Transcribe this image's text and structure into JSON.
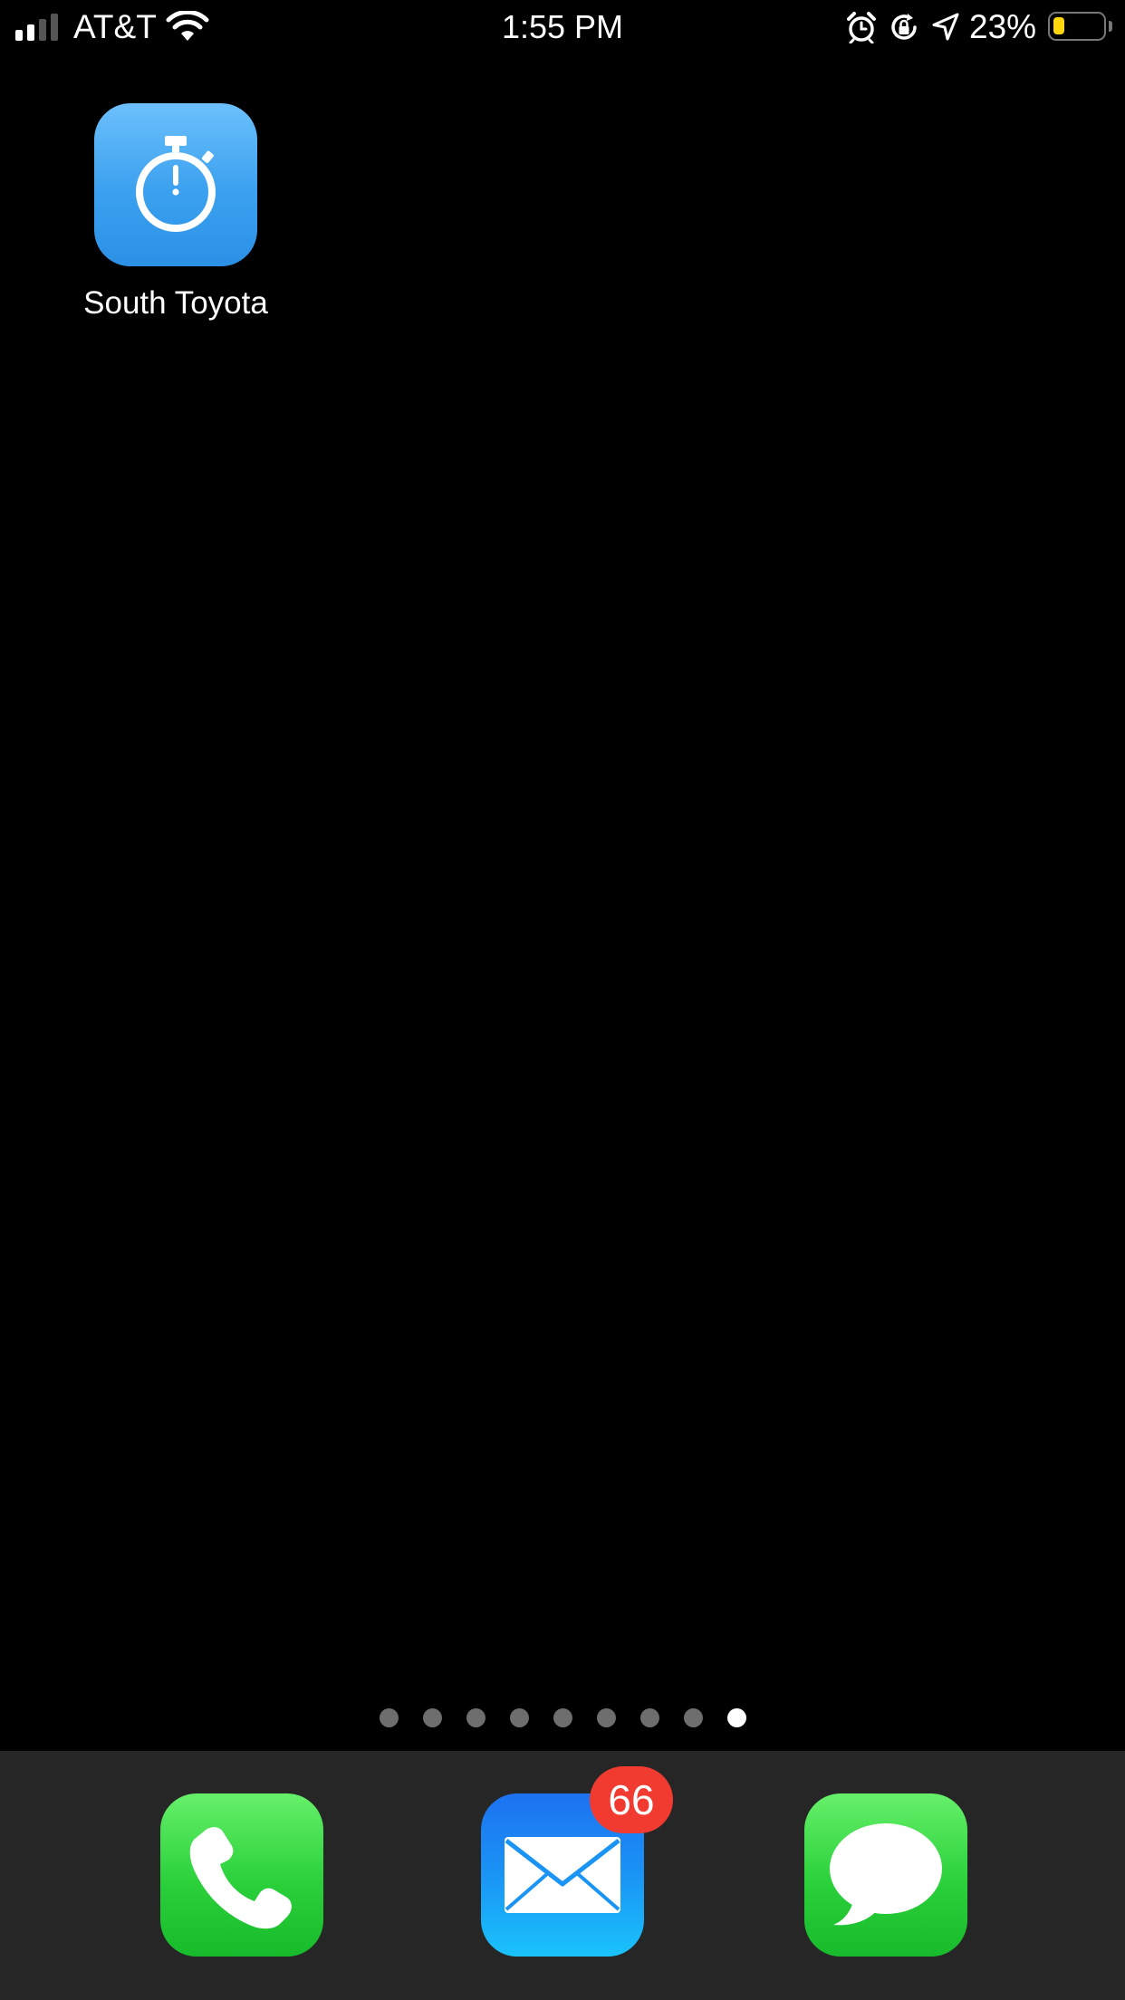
{
  "status_bar": {
    "carrier": "AT&T",
    "time": "1:55 PM",
    "battery_percent": "23%",
    "battery_level": 0.23,
    "signal_bars": 4,
    "signal_strength": 2,
    "icons": [
      "signal-icon",
      "wifi-icon",
      "alarm-icon",
      "rotation-lock-icon",
      "location-arrow-icon",
      "battery-icon"
    ],
    "battery_color": "#ffd60a"
  },
  "home": {
    "apps": [
      {
        "label": "South Toyota",
        "icon": "stopwatch-icon",
        "color": "#3aa0ef"
      }
    ]
  },
  "page_indicator": {
    "total": 9,
    "current": 9
  },
  "dock": {
    "apps": [
      {
        "name": "Phone",
        "icon": "phone-icon",
        "color": "#2ad03a"
      },
      {
        "name": "Mail",
        "icon": "mail-icon",
        "color": "#1a94f5",
        "badge": "66"
      },
      {
        "name": "Messages",
        "icon": "message-bubble-icon",
        "color": "#2ad03a"
      }
    ],
    "badge_color": "#f23b30"
  }
}
